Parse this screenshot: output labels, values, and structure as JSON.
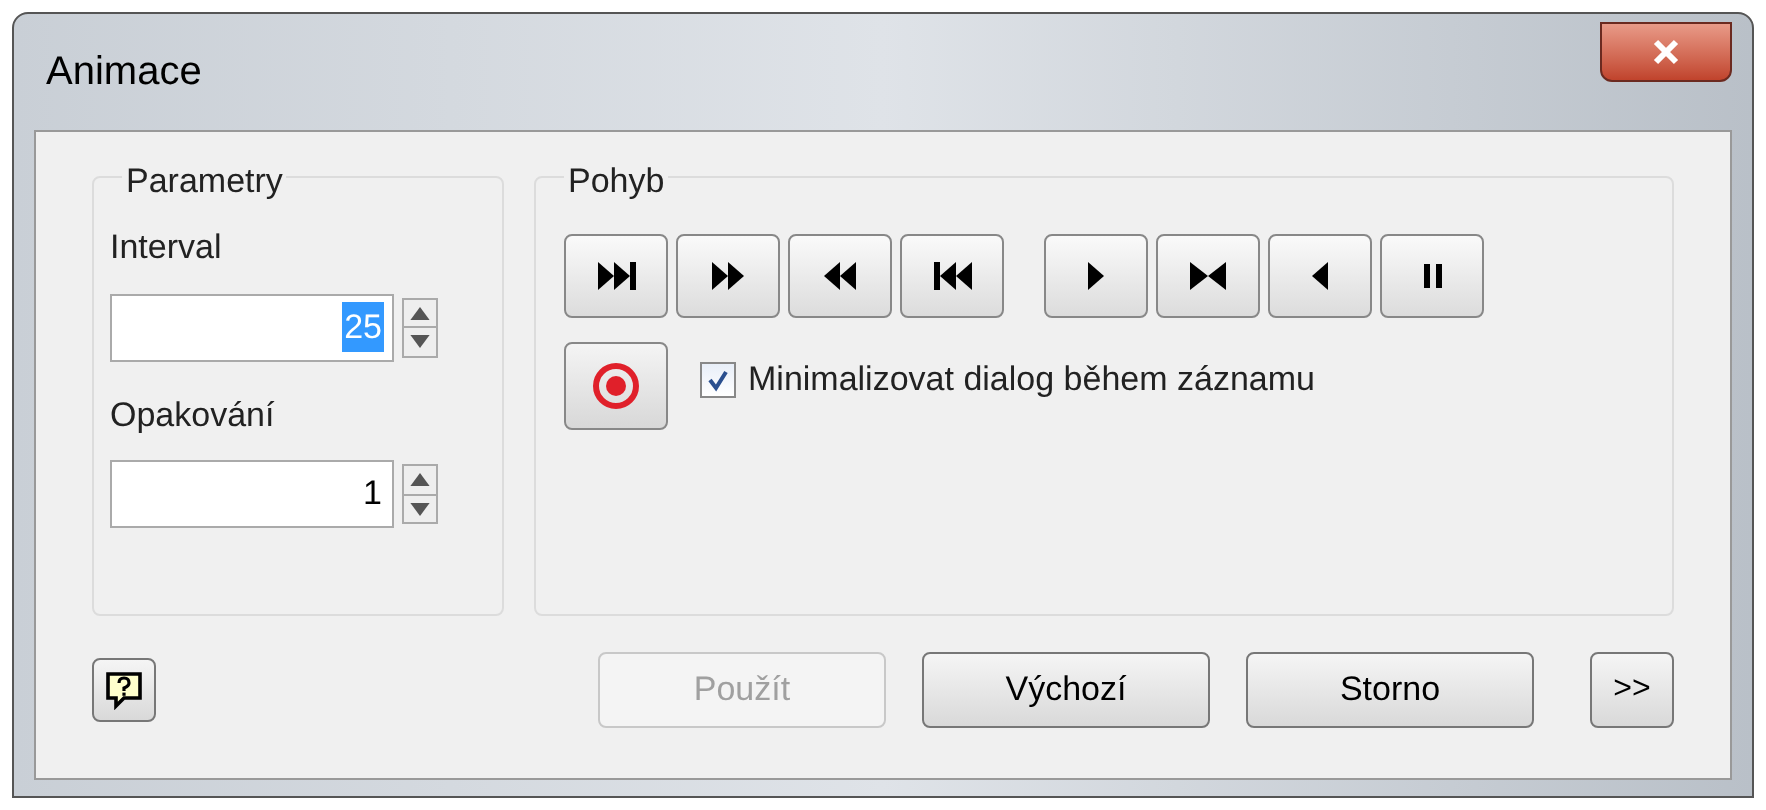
{
  "window": {
    "title": "Animace"
  },
  "parameters": {
    "title": "Parametry",
    "fields": [
      {
        "label": "Interval",
        "value": "25",
        "selected": true
      },
      {
        "label": "Opakování",
        "value": "1",
        "selected": false
      }
    ]
  },
  "motion": {
    "title": "Pohyb",
    "transport": [
      {
        "kind": "to-end"
      },
      {
        "kind": "forward"
      },
      {
        "kind": "backward"
      },
      {
        "kind": "to-start"
      },
      {
        "kind": "play"
      },
      {
        "kind": "bounce"
      },
      {
        "kind": "reverse"
      },
      {
        "kind": "pause"
      }
    ],
    "record_checkbox": {
      "label": "Minimalizovat dialog během záznamu",
      "checked": true
    }
  },
  "footer": {
    "buttons": [
      {
        "label": "Použít",
        "disabled": true
      },
      {
        "label": "Výchozí",
        "disabled": false
      },
      {
        "label": "Storno",
        "disabled": false
      }
    ],
    "more": ">>"
  }
}
